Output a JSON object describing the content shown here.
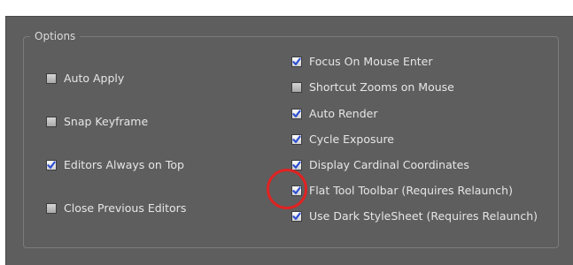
{
  "group": {
    "title": "Options"
  },
  "left_options": [
    {
      "label": "Auto Apply",
      "checked": false
    },
    {
      "label": "Snap Keyframe",
      "checked": false
    },
    {
      "label": "Editors Always on Top",
      "checked": true
    },
    {
      "label": "Close Previous Editors",
      "checked": false
    }
  ],
  "right_options": [
    {
      "label": "Focus On Mouse Enter",
      "checked": true
    },
    {
      "label": "Shortcut Zooms on Mouse",
      "checked": false
    },
    {
      "label": "Auto Render",
      "checked": true
    },
    {
      "label": "Cycle Exposure",
      "checked": true
    },
    {
      "label": "Display Cardinal Coordinates",
      "checked": true
    },
    {
      "label": "Flat Tool Toolbar (Requires Relaunch)",
      "checked": true
    },
    {
      "label": "Use Dark StyleSheet (Requires Relaunch)",
      "checked": true
    }
  ],
  "colors": {
    "panel_bg": "#5e5e5e",
    "check_mark": "#2d4fd0",
    "annotation": "#e02222"
  }
}
